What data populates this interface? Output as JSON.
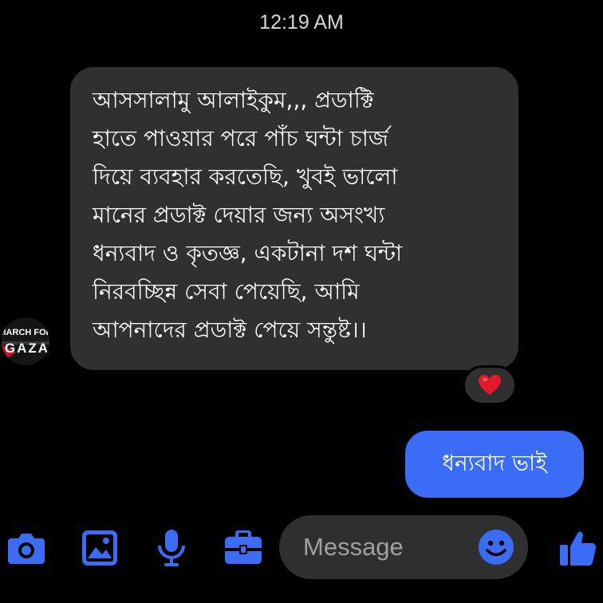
{
  "timestamp": "12:19 AM",
  "incoming_message": {
    "lines": [
      "আসসালামু আলাইকুম,,, প্রডাক্টি",
      "হাতে পাওয়ার পরে পাঁচ ঘন্টা চার্জ",
      "দিয়ে ব্যবহার করতেছি, খুবই ভালো",
      "মানের প্রডাক্ট দেয়ার জন্য অসংখ্য",
      "ধন্যবাদ ও কৃতজ্ঞ, একটানা দশ ঘন্টা",
      "নিরবচ্ছিন্ন সেবা পেয়েছি, আমি",
      "আপনাদের প্রডাক্ট পেয়ে সন্তুষ্ট।।"
    ],
    "reaction": "heart"
  },
  "avatar": {
    "line1": "MARCH FOR",
    "line2": "GAZA"
  },
  "outgoing_message": "ধন্যবাদ ভাই",
  "composer": {
    "placeholder": "Message",
    "icons": [
      "camera-icon",
      "gallery-icon",
      "microphone-icon",
      "briefcase-icon",
      "emoji-icon",
      "thumbs-up-icon"
    ]
  },
  "colors": {
    "background": "#000000",
    "incoming_bubble": "#303030",
    "outgoing_bubble": "#3b6cf6",
    "accent": "#3b6cf6",
    "heart": "#e0192b"
  }
}
